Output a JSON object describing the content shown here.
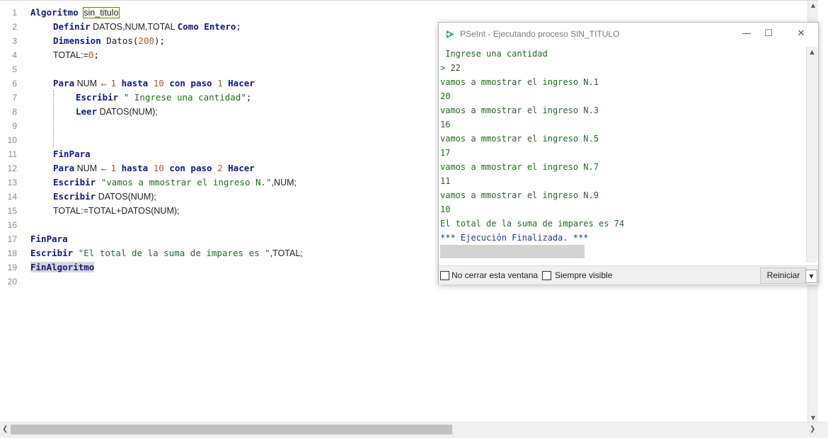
{
  "editor": {
    "line_numbers": [
      "1",
      "2",
      "3",
      "4",
      "5",
      "6",
      "7",
      "8",
      "9",
      "10",
      "11",
      "12",
      "13",
      "14",
      "15",
      "16",
      "17",
      "18",
      "19",
      "20"
    ],
    "tokens": {
      "algoritmo": "Algoritmo",
      "sin_titulo": "sin_titulo",
      "definir": "Definir",
      "definir_vars": " DATOS,NUM,TOTAL ",
      "como_entero": "Como Entero",
      "semi": ";",
      "dimension": "Dimension",
      "datos_paren": " Datos(",
      "n200": "200",
      "close_semi": ");",
      "total_assign": "TOTAL:=",
      "n0": "0",
      "para": "Para",
      "num_arrow": " NUM ← ",
      "n1": "1",
      "hasta": "hasta",
      "n10": "10",
      "con_paso": "con paso",
      "n2": "2",
      "hacer": "Hacer",
      "escribir": "Escribir",
      "str_ingrese": "\" Ingrese una cantidad\"",
      "leer": "Leer",
      "leer_arg": " DATOS(NUM);",
      "finpara": "FinPara",
      "str_vamos": "\"vamos a mmostrar el ingreso N.\"",
      "vamos_tail": ",NUM;",
      "escribir_datos": " DATOS(NUM);",
      "total_sum": "TOTAL:=TOTAL+DATOS(NUM);",
      "str_total": "\"El total de la suma de impares es \"",
      "total_tail": ",TOTAL;",
      "finalgoritmo": "FinAlgoritmo"
    }
  },
  "run_window": {
    "title": "PSeInt - Ejecutando proceso SIN_TITULO",
    "minimize_glyph": "—",
    "maximize_glyph": "☐",
    "close_glyph": "✕",
    "output_lines": [
      " Ingrese una cantidad",
      "> 22",
      "vamos a mmostrar el ingreso N.1",
      "20",
      "vamos a mmostrar el ingreso N.3",
      "16",
      "vamos a mmostrar el ingreso N.5",
      "17",
      "vamos a mmostrar el ingreso N.7",
      "11",
      "vamos a mmostrar el ingreso N.9",
      "10",
      "El total de la suma de impares es 74",
      "*** Ejecución Finalizada. ***"
    ],
    "no_cerrar_label": "No cerrar esta ventana",
    "siempre_visible_label": "Siempre visible",
    "reiniciar_label": "Reiniciar",
    "accent_color": "#2bb34a"
  },
  "scroll": {
    "up_glyph": "▲",
    "down_glyph": "▼",
    "left_glyph": "❮",
    "right_glyph": "❯"
  }
}
